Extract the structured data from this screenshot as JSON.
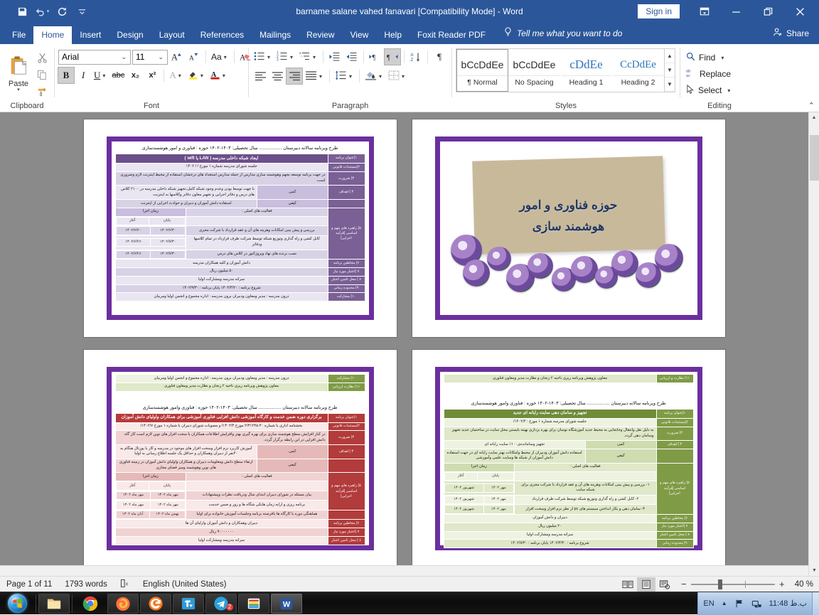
{
  "titlebar": {
    "document_title": "barname salane vahed fanavari [Compatibility Mode]  -  Word",
    "quick_access": [
      {
        "name": "save-icon",
        "label": "Save"
      },
      {
        "name": "undo-icon",
        "label": "Undo"
      },
      {
        "name": "redo-icon",
        "label": "Repeat"
      },
      {
        "name": "customize-qat-icon",
        "label": "Customize Quick Access Toolbar"
      }
    ],
    "sign_in": "Sign in",
    "ribbon_display_options": "Ribbon Display Options",
    "minimize": "Minimize",
    "restore": "Restore Down",
    "close": "Close"
  },
  "tabs": [
    {
      "label": "File",
      "active": false
    },
    {
      "label": "Home",
      "active": true
    },
    {
      "label": "Insert",
      "active": false
    },
    {
      "label": "Design",
      "active": false
    },
    {
      "label": "Layout",
      "active": false
    },
    {
      "label": "References",
      "active": false
    },
    {
      "label": "Mailings",
      "active": false
    },
    {
      "label": "Review",
      "active": false
    },
    {
      "label": "View",
      "active": false
    },
    {
      "label": "Help",
      "active": false
    },
    {
      "label": "Foxit Reader PDF",
      "active": false
    }
  ],
  "tell_me": "Tell me what you want to do",
  "share": "Share",
  "ribbon": {
    "clipboard": {
      "group_label": "Clipboard",
      "paste_label": "Paste",
      "cut_label": "Cut",
      "copy_label": "Copy",
      "format_painter_label": "Format Painter"
    },
    "font": {
      "group_label": "Font",
      "font_name": "Arial",
      "font_size": "11",
      "grow_font": "Grow Font",
      "shrink_font": "Shrink Font",
      "change_case": "Aa",
      "clear_formatting": "Clear All Formatting",
      "bold": "B",
      "italic": "I",
      "underline": "U",
      "strikethrough": "abc",
      "subscript": "x₂",
      "superscript": "x²",
      "text_effects": "A",
      "highlight": "Text Highlight Color",
      "font_color": "A"
    },
    "paragraph": {
      "group_label": "Paragraph",
      "bullets": "Bullets",
      "numbering": "Numbering",
      "multilevel": "Multilevel List",
      "decrease_indent": "Decrease Indent",
      "increase_indent": "Increase Indent",
      "ltr": "Left-to-Right Text Direction",
      "rtl": "Right-to-Left Text Direction",
      "sort": "Sort",
      "show_marks": "Show/Hide ¶",
      "align_left": "Align Left",
      "align_center": "Center",
      "align_right": "Align Right",
      "justify": "Justify",
      "line_spacing": "Line and Paragraph Spacing",
      "shading": "Shading",
      "borders": "Borders"
    },
    "styles": {
      "group_label": "Styles",
      "items": [
        {
          "preview": "bCcDdEe",
          "name": "¶ Normal",
          "selected": true
        },
        {
          "preview": "bCcDdEe",
          "name": "No Spacing",
          "selected": false
        },
        {
          "preview": "cDdEe",
          "name": "Heading 1",
          "selected": false
        },
        {
          "preview": "CcDdEe",
          "name": "Heading 2",
          "selected": false
        }
      ],
      "scroll_up": "▲",
      "scroll_down": "▼",
      "more": "▼"
    },
    "editing": {
      "group_label": "Editing",
      "find": "Find",
      "replace": "Replace",
      "select": "Select"
    },
    "collapse": "Collapse the Ribbon"
  },
  "document": {
    "pages": [
      {
        "id": "page-table-purple",
        "kind": "table",
        "theme": "t-purple",
        "heading": "طرح ویرنامه سالانه دبیرستان ..................  سال تحصیلی: ۱۴۰۳-۱۴۰۲   حوزه : فناوری و امور هوشمندسازی",
        "band": "ایجاد شبکه داخلی مدرسه ( LAN  یا  wifi )",
        "rows": [
          {
            "label": "۱)عنوان برنامه",
            "type": "band"
          },
          {
            "label": "۲)مستندات قانونی",
            "text": "جلسه شورای مدرسه شماره ۱ مورخ  /  / ۱۴۰۲"
          },
          {
            "label": "۳) ضرورت",
            "text": "در جهت برنامه توسعه یجهم وهوشمند سازی مدارس از جمله مدارس استعداد های درخشان استفاده از محیط اینترنت لازم وضروری است."
          },
          {
            "label": "۴ ) اهداف",
            "sub": "کمی",
            "text": "با جهت توسعا بودن وعدم وجود  شبکه کامل،تجهیز شبکه داخلی مدرسه در  ۲۱۰۰ کلاس های درس و دفاتر اجرایی و تجهیز معاون دفاتر وکلاسها به اینترنت"
          },
          {
            "label": "",
            "sub": "کیفی",
            "text": "استفاده دانش آموزان و دبیران  و حوادث اجرایی از اینترنت"
          },
          {
            "label": "۵) راهبرد های مهم و اساسی [قرآیند اجرایی]",
            "type": "activities",
            "activities_header": "فعالیت های اصلی :",
            "time_header": "زمان اجرا",
            "start_header": "آغاز",
            "end_header": "پایان",
            "items": [
              {
                "text": "بررسی و پیش بینی امکانات وهزینه های آن و عقد قرارداد با شرکت مجری",
                "start": "۱۴۰۲/۶/۲۰",
                "end": "۱۴۰۲/۶/۳۰"
              },
              {
                "text": "کابل کشی و راه گذاری وتوزیع شبکه توسط شرکت طرف قرارداد در تمام کلاسها ودفاتر",
                "start": "۱۴۰۲/۶/۲۶",
                "end": "۱۴۰۲/۷/۳۰"
              },
              {
                "text": "نصب برنده های نهاد وپروژکتور در کلاس های درس",
                "start": "۱۴۰۲/۶/۲۶",
                "end": "۱۴۰۲/۷/۳۰"
              }
            ]
          },
          {
            "label": "۶) مخاطین برنامه",
            "text": "دانش آموزان و کلیه همکاران مدرسه"
          },
          {
            "label": "۷ )اعتبار مورد نیاز",
            "text": "۵۰ میلیون ریال"
          },
          {
            "label": "۸ ) محل تامین اعتبار",
            "text": "سرانه مدرسه ومشارکت اولیا"
          },
          {
            "label": "۹) محدوده زمانی",
            "text": "شروع برنامه : ۱۴۰۲/۴/۲۰          پایان برنامه : ۱۴۰۲/۹/۳۰"
          },
          {
            "label": "۱۰) مشارکت",
            "text": "درون مدرسه :  مدیر ومعاون ودبیران          برون مدرسه : اداره مجموع  و انجمن اولیا ومربیان"
          }
        ]
      },
      {
        "id": "page-title-slide",
        "kind": "title-slide",
        "title_line1": "حوزه فناوری و امور",
        "title_line2": "هوشمند سازی"
      },
      {
        "id": "page-table-red",
        "kind": "table-red",
        "theme": "t-red",
        "green_rows": [
          {
            "label": "۱۰) مشارکت",
            "text": "درون مدرسه :  مدیر ومعاون ودبیران          برون مدرسه : اداره مجموع  و انجمن اولیا ومربیان"
          },
          {
            "label": "۱۱) نظارت ارزیابی",
            "text": "معاون پژوهش وبرنامه ریزی ناحیه ۲ زنجان و نظارت مدیر ومعاون فناوری"
          }
        ],
        "heading": "طرح ویرنامه سالانه دبیرستان ..................  سال تحصیلی: ۱۴۰۳-۱۴۰۲   حوزه : فناوری وامور هوشمندسازی",
        "band": "برگزاری دوره ضمن خدمت و کارگاه آموزشی دانش افزایی فناوری آموزشی برای همکاران واولیای دانش آموزان",
        "rows": [
          {
            "label": "۱)عنوان برنامه",
            "type": "band"
          },
          {
            "label": "۲)مستندات قانونی",
            "text": "بخشنامه اداری با شماره ۴۰-۲/۳۱۲۴۵ مورخ ۱۴۰۲/۴/      و مصوبات شورای دبیران با شماره ۱ مورخ  ۱۴۰۲/۷/"
          },
          {
            "label": "۳) ضرورت",
            "text": "در کنار افزایش سطح هوشمند سازی  برای بهره گیری بهتر وافزایش اطلاعات همکاران با سخت افزار های نوین لازم است کار گاه دانش افزایی در این رابطه برگزار گردد."
          },
          {
            "label": "۴ ) اهداف",
            "sub": "کمی",
            "text": "آموزش کاربرد نرم افزار وسخت افزار های موجود در مدرسه و کار با پورتال هنگام به ۴۰نفر از دبیران وهمکاران و حداقل یک جلسه اطلاع رسانی به اولیا"
          },
          {
            "label": "",
            "sub": "کیفی",
            "text": "ارتقاء سطح دانش ومعلومات دبیران و همکاران واولیای دانش آموزان در زمینه فناوری های نوین وهوشمند ومیز فضای مجازی"
          },
          {
            "label": "۵) راهبرد های مهم و اساسی [قرآیند اجرایی]",
            "type": "activities",
            "activities_header": "فعالیت های اصلی :",
            "time_header": "زمان اجرا",
            "start_header": "آغاز",
            "end_header": "پایان",
            "items": [
              {
                "text": "بیان مسئله در شورای دبیران ابتدای سال ودریافت نظرات وپیشنهادات",
                "start": "مهر ماه ۱۴۰۲",
                "end": "مهر ماه ۱۴۰۲"
              },
              {
                "text": "برنامه ریزی و ارایه زمان هایکی شگاه ها و زور و ضمن خدمت",
                "start": "مهر ماه ۱۴۰۲",
                "end": "مهر ماه ۱۴۰۲"
              },
              {
                "text": "هماهنگی دوره با کارگاه ها بافرصته برنامه وجلسات آموزش خانواده برای اولیا",
                "start": "آبان ماه ۱۴۰۲",
                "end": "بهمن ماه ۱۴۰۲"
              }
            ]
          },
          {
            "label": "۶) مخاطین برنامه",
            "text": "دبیران وهمکاران  و دانش آموزان وازلیای آن ها"
          },
          {
            "label": "۷ )اعتبار مورد نیاز",
            "text": "۹۰۰۰۰۰۰۰ ریال"
          },
          {
            "label": "۸ ) محل تامین اعتبار",
            "text": "سرانه مدرسه ومشارکت اولیا"
          }
        ]
      },
      {
        "id": "page-table-green",
        "kind": "table-green",
        "theme": "t-green",
        "green_rows": [
          {
            "label": "۱۱) نظارت و ارزیابی",
            "text": "معاون پژوهش وبرنامه ریزی ناحیه ۲ زنجان و نظارت مدیر ومعاون فناوری"
          }
        ],
        "heading": "طرح ویرنامه سالانه دبیرستان ..................  سال تحصیلی: ۱۴۰۳-۱۴۰۲   حوزه : فناوری وامور هوشمندسازی",
        "band": "تجهیز و سامان دهی سایت رایانه ای جدید",
        "rows": [
          {
            "label": "۱)عنوان برنامه",
            "type": "band"
          },
          {
            "label": "۲)مستندات قانونی",
            "text": "جلسه شورای مدرسه شماره ۱ مورخ : ۱۴۰۲/۴/"
          },
          {
            "label": "۳) ضرورت",
            "text": "به دلیل نقل وانتقال وجابجایی به محیط جدید آموزشگاه نوسان برای بهره برداری بهینه بایستی محل سایت در ساختمان جدید  تجهیز وسامان دهی گردد."
          },
          {
            "label": "۴ ) اهداف",
            "sub": "کمی",
            "text": "تجهیز وسامانده‌ی۱۰۰٪ سایت رایانه ای"
          },
          {
            "label": "",
            "sub": "کیفی",
            "text": "استفاده دانش آموزان ودبیران از محیط وامکانات بهتر  سایت رایانه ای در جهت استفاده دانش آموزان از شبکه ها وسایت علمی وآموزشی"
          },
          {
            "label": "۵) راهبرد های مهم و اساسی [قرآیند اجرایی]",
            "type": "activities",
            "activities_header": "فعالیت های اصلی :",
            "time_header": "زمان اجرا",
            "start_header": "آغاز",
            "end_header": "پایان",
            "items": [
              {
                "text": "۱- بررسی و پیش بینی امکانات وهزینه های آن و عقد قرارداد با شرکت مجری برای شبکه سایت",
                "start": "شهریور ۱۴۰۲",
                "end": "مهر ۱۴۰۲"
              },
              {
                "text": "۲- کابل کشی و راه گذاری وتوزیع شبکه توسط شرکت طرف قرارداد",
                "start": "شهریور ۱۴۰۲",
                "end": "مهر ۱۴۰۲"
              },
              {
                "text": "۳- سامان دهی و بکار انداختن سیستم های pc از نظر نرم افزار وسخت افزار",
                "start": "شهریور ۱۴۰۲",
                "end": "مهر ۱۴۰۲"
              }
            ]
          },
          {
            "label": "۶) مخاطین برنامه",
            "text": "دبیران و دانش آموزان"
          },
          {
            "label": "۷ )اعتبار مورد نیاز",
            "text": "۲۰ میلیون ریال"
          },
          {
            "label": "۸ ) محل تامین اعتبار",
            "text": "سرانه مدرسه ومشارکت اولیا"
          },
          {
            "label": "۹) محدوده زمانی",
            "text": "شروع برنامه : ۱۴۰۲/۴/۳۰          پایان برنامه : ۱۴۰۲/۷/۳۰"
          }
        ]
      }
    ]
  },
  "statusbar": {
    "page": "Page 1 of 11",
    "words": "1793 words",
    "proofing_icon": "proofing-errors-icon",
    "language": "English (United States)",
    "views": [
      {
        "name": "read-mode",
        "on": false
      },
      {
        "name": "print-layout",
        "on": true
      },
      {
        "name": "web-layout",
        "on": false
      }
    ],
    "zoom_out": "−",
    "zoom_in": "+",
    "zoom_level": "40 %"
  },
  "taskbar": {
    "start": "Start",
    "items": [
      {
        "name": "file-explorer-icon",
        "label": "Windows Explorer",
        "active": false,
        "badge": ""
      },
      {
        "name": "chrome-icon",
        "label": "Google Chrome",
        "active": false,
        "badge": ""
      },
      {
        "name": "firefox-icon",
        "label": "Mozilla Firefox",
        "active": false,
        "badge": ""
      },
      {
        "name": "maxthon-icon",
        "label": "Browser",
        "active": false,
        "badge": ""
      },
      {
        "name": "freedownload-icon",
        "label": "Free Download Manager",
        "active": false,
        "badge": ""
      },
      {
        "name": "telegram-icon",
        "label": "Telegram",
        "active": false,
        "badge": "2"
      },
      {
        "name": "winrar-icon",
        "label": "WinRAR",
        "active": false,
        "badge": ""
      },
      {
        "name": "word-icon",
        "label": "Microsoft Word",
        "active": true,
        "badge": ""
      }
    ],
    "tray": {
      "language": "EN",
      "show_hidden_icons": "▲",
      "action_center_icon": "flag-icon",
      "network_icon": "network-icon",
      "clock": "11:48 ب.ظ"
    }
  }
}
